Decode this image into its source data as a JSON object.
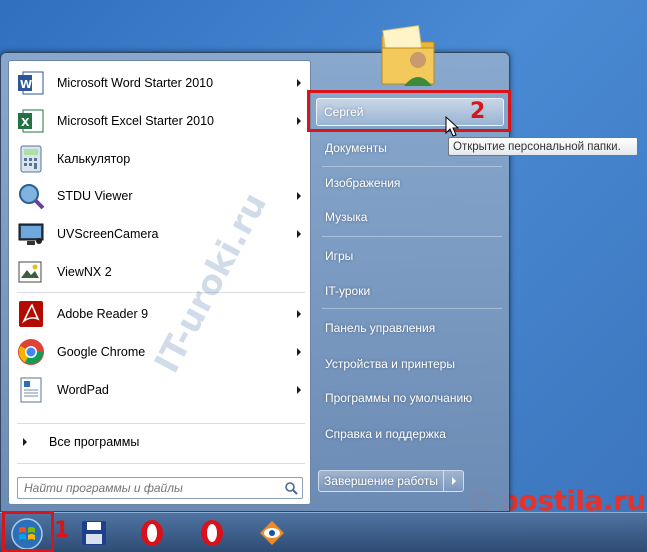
{
  "programs": [
    {
      "label": "Microsoft Word Starter 2010",
      "icon": "word-icon",
      "arrow": true
    },
    {
      "label": "Microsoft Excel Starter 2010",
      "icon": "excel-icon",
      "arrow": true
    },
    {
      "label": "Калькулятор",
      "icon": "calculator-icon",
      "arrow": false
    },
    {
      "label": "STDU Viewer",
      "icon": "stdu-viewer-icon",
      "arrow": true
    },
    {
      "label": "UVScreenCamera",
      "icon": "uvscreencamera-icon",
      "arrow": true
    },
    {
      "label": "ViewNX 2",
      "icon": "viewnx-icon",
      "arrow": false
    },
    {
      "label": "Adobe Reader 9",
      "icon": "adobe-reader-icon",
      "arrow": true
    },
    {
      "label": "Google Chrome",
      "icon": "chrome-icon",
      "arrow": true
    },
    {
      "label": "WordPad",
      "icon": "wordpad-icon",
      "arrow": true
    }
  ],
  "all_programs": "Все программы",
  "search_placeholder": "Найти программы и файлы",
  "right_items": [
    {
      "label": "Сергей",
      "highlight": true
    },
    {
      "label": "Документы"
    },
    {
      "label": "Изображения"
    },
    {
      "label": "Музыка"
    },
    {
      "label": "Игры"
    },
    {
      "label": "IT-уроки"
    },
    {
      "label": "Панель управления"
    },
    {
      "label": "Устройства и принтеры"
    },
    {
      "label": "Программы по умолчанию"
    },
    {
      "label": "Справка и поддержка"
    }
  ],
  "tooltip": "Открытие персональной папки.",
  "shutdown_label": "Завершение работы",
  "annotations": {
    "num1": "1",
    "num2": "2"
  },
  "watermark_diagonal": "IT-uroki.ru",
  "watermark_site": "postila.ru",
  "colors": {
    "annotation_red": "#d7151b",
    "highlight": "#ffffff"
  }
}
